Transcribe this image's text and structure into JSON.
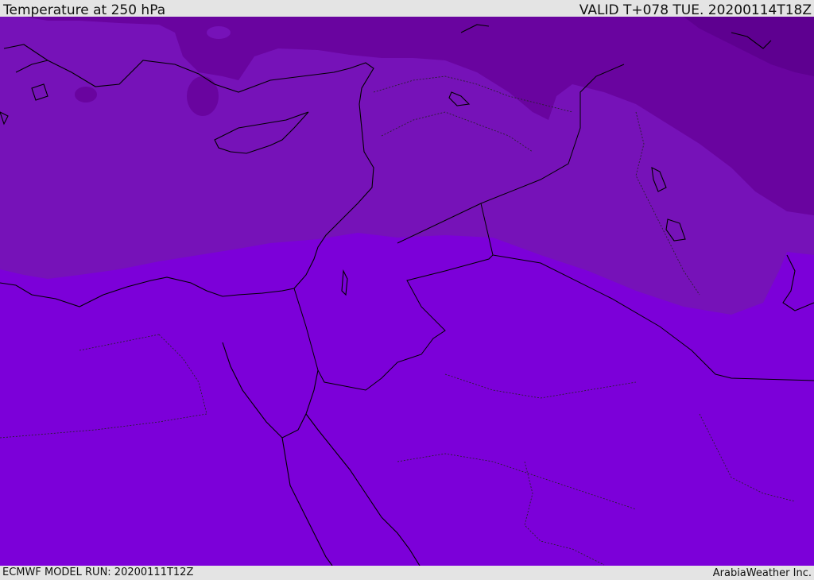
{
  "header": {
    "title": "Temperature at 250 hPa",
    "valid": "VALID T+078 TUE. 20200114T18Z"
  },
  "footer": {
    "model_run": "ECMWF MODEL RUN: 20200111T12Z",
    "credit": "ArabiaWeather Inc."
  },
  "map": {
    "region": "Eastern Mediterranean / Middle East",
    "field": "temperature",
    "level": "250 hPa",
    "colors": {
      "warm_band": "#7c00d9",
      "mid_band": "#7612b8",
      "cool_band": "#69049f",
      "cold_band": "#5e0090",
      "coastline": "#000000"
    }
  }
}
